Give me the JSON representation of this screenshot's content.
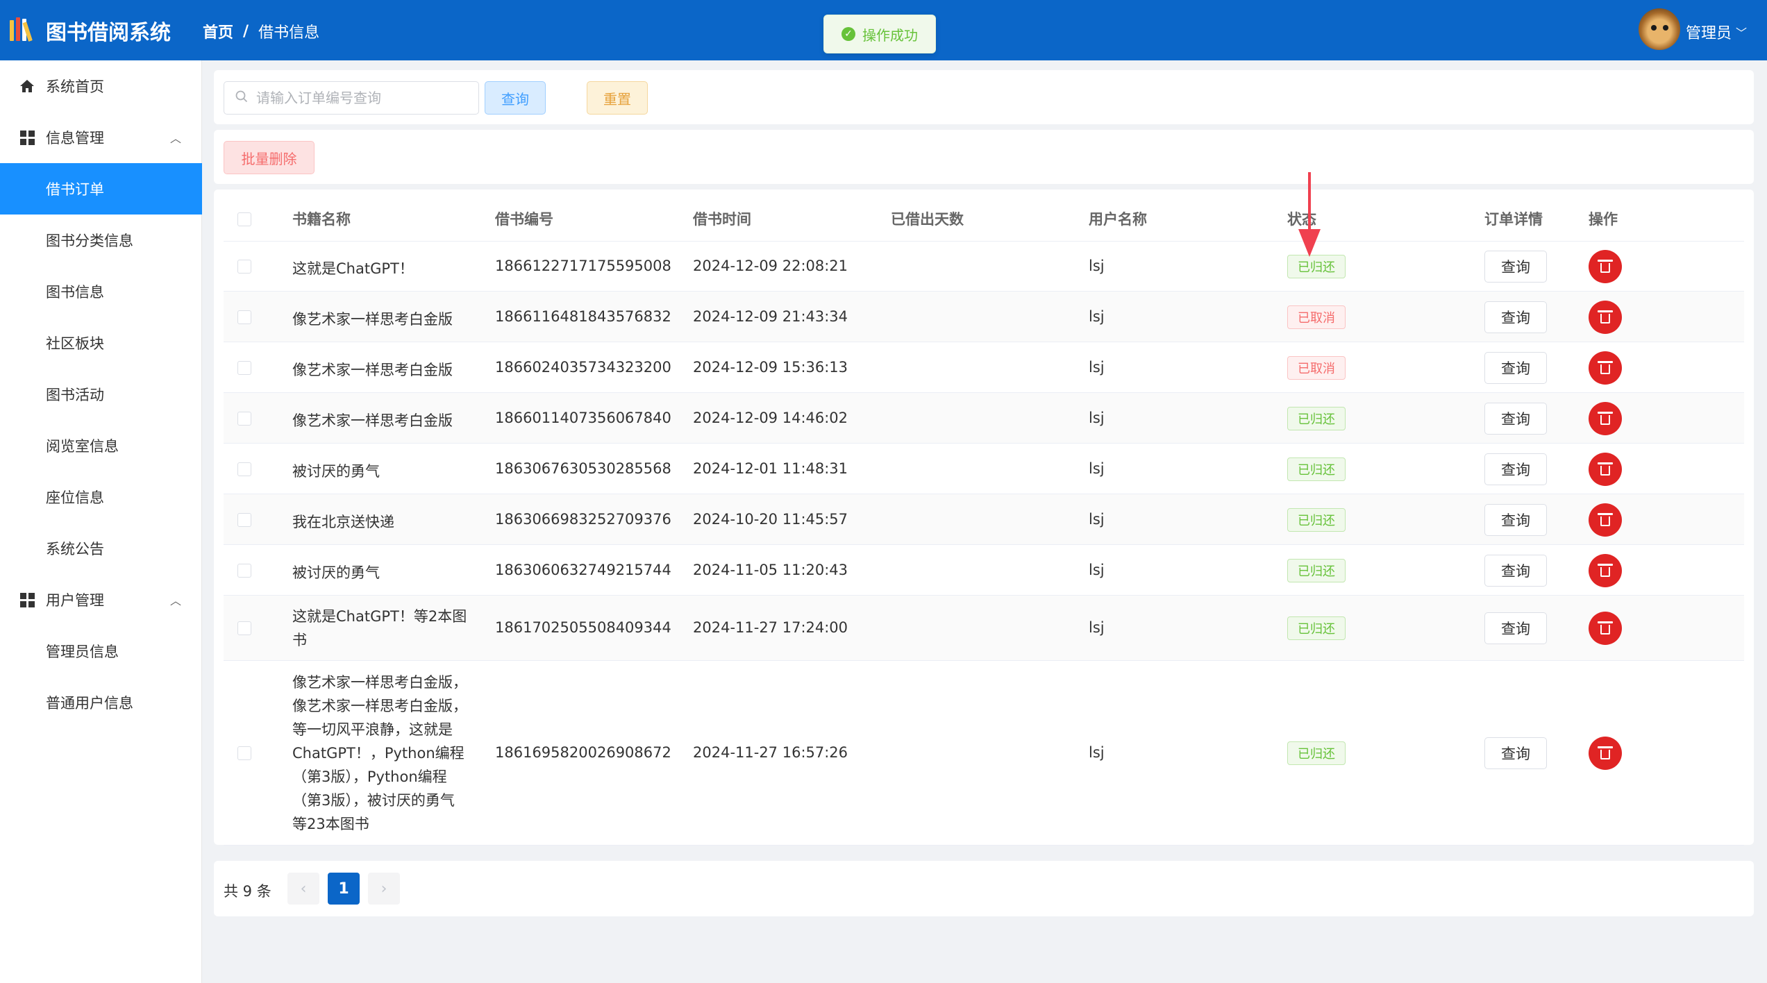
{
  "header": {
    "app_title": "图书借阅系统",
    "breadcrumb_home": "首页",
    "breadcrumb_sep": "/",
    "breadcrumb_current": "借书信息",
    "toast": "操作成功",
    "user_name": "管理员",
    "bg_color": "#0b66c8"
  },
  "sidebar": {
    "items": [
      {
        "label": "系统首页",
        "icon": "home-icon"
      },
      {
        "label": "信息管理",
        "icon": "grid-icon",
        "expandable": true
      },
      {
        "label": "借书订单",
        "active": true
      },
      {
        "label": "图书分类信息"
      },
      {
        "label": "图书信息"
      },
      {
        "label": "社区板块"
      },
      {
        "label": "图书活动"
      },
      {
        "label": "阅览室信息"
      },
      {
        "label": "座位信息"
      },
      {
        "label": "系统公告"
      },
      {
        "label": "用户管理",
        "icon": "grid-icon",
        "expandable": true
      },
      {
        "label": "管理员信息"
      },
      {
        "label": "普通用户信息"
      }
    ],
    "active_color": "#1890ff"
  },
  "search": {
    "placeholder": "请输入订单编号查询",
    "query_label": "查询",
    "reset_label": "重置"
  },
  "actions": {
    "batch_delete_label": "批量删除"
  },
  "table": {
    "columns": [
      "书籍名称",
      "借书编号",
      "借书时间",
      "已借出天数",
      "用户名称",
      "状态",
      "订单详情",
      "操作"
    ],
    "rows": [
      {
        "book": "这就是ChatGPT！",
        "code": "1866122717175595008",
        "time": "2024-12-09 22:08:21",
        "days": "",
        "user": "lsj",
        "status": "已归还",
        "status_type": "ok",
        "detail": "查询"
      },
      {
        "book": "像艺术家一样思考白金版",
        "code": "1866116481843576832",
        "time": "2024-12-09 21:43:34",
        "days": "",
        "user": "lsj",
        "status": "已取消",
        "status_type": "cancel",
        "detail": "查询"
      },
      {
        "book": "像艺术家一样思考白金版",
        "code": "1866024035734323200",
        "time": "2024-12-09 15:36:13",
        "days": "",
        "user": "lsj",
        "status": "已取消",
        "status_type": "cancel",
        "detail": "查询"
      },
      {
        "book": "像艺术家一样思考白金版",
        "code": "1866011407356067840",
        "time": "2024-12-09 14:46:02",
        "days": "",
        "user": "lsj",
        "status": "已归还",
        "status_type": "ok",
        "detail": "查询"
      },
      {
        "book": "被讨厌的勇气",
        "code": "1863067630530285568",
        "time": "2024-12-01 11:48:31",
        "days": "",
        "user": "lsj",
        "status": "已归还",
        "status_type": "ok",
        "detail": "查询"
      },
      {
        "book": "我在北京送快递",
        "code": "1863066983252709376",
        "time": "2024-10-20 11:45:57",
        "days": "",
        "user": "lsj",
        "status": "已归还",
        "status_type": "ok",
        "detail": "查询"
      },
      {
        "book": "被讨厌的勇气",
        "code": "1863060632749215744",
        "time": "2024-11-05 11:20:43",
        "days": "",
        "user": "lsj",
        "status": "已归还",
        "status_type": "ok",
        "detail": "查询"
      },
      {
        "book_lines": [
          "这就是ChatGPT！等2本图",
          "书"
        ],
        "code": "1861702505508409344",
        "time": "2024-11-27 17:24:00",
        "days": "",
        "user": "lsj",
        "status": "已归还",
        "status_type": "ok",
        "detail": "查询"
      },
      {
        "book_lines": [
          "像艺术家一样思考白金版，",
          "像艺术家一样思考白金版，",
          "等一切风平浪静，这就是",
          "ChatGPT！，Python编程",
          "（第3版），Python编程",
          "（第3版），被讨厌的勇气",
          "等23本图书"
        ],
        "code": "1861695820026908672",
        "time": "2024-11-27 16:57:26",
        "days": "",
        "user": "lsj",
        "status": "已归还",
        "status_type": "ok",
        "detail": "查询"
      }
    ]
  },
  "pagination": {
    "total_text": "共 9 条",
    "current_page": "1",
    "prev_icon": "chevron-left-icon",
    "next_icon": "chevron-right-icon"
  }
}
